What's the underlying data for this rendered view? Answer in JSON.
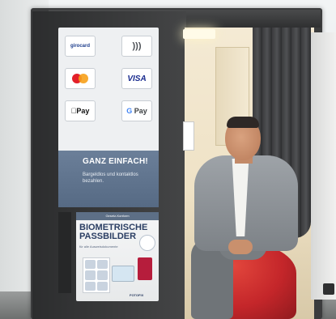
{
  "screen": {
    "payments": [
      "girocard",
      "contactless",
      "mastercard",
      "VISA",
      "Apple Pay",
      "Google Pay"
    ],
    "apple_pay_label": "Pay",
    "google_pay_label": "Pay",
    "visa_label": "VISA",
    "girocard_label": "girocard",
    "headline": "GANZ EINFACH!",
    "subline": "Bargeldlos und kontaktlos bezahlen."
  },
  "poster": {
    "strap": "Gesetz-Konform",
    "title": "BIOMETRISCHE PASSBILDER",
    "subtitle": "für alle Ausweisdokumente",
    "brand": "FOTOFIX"
  }
}
